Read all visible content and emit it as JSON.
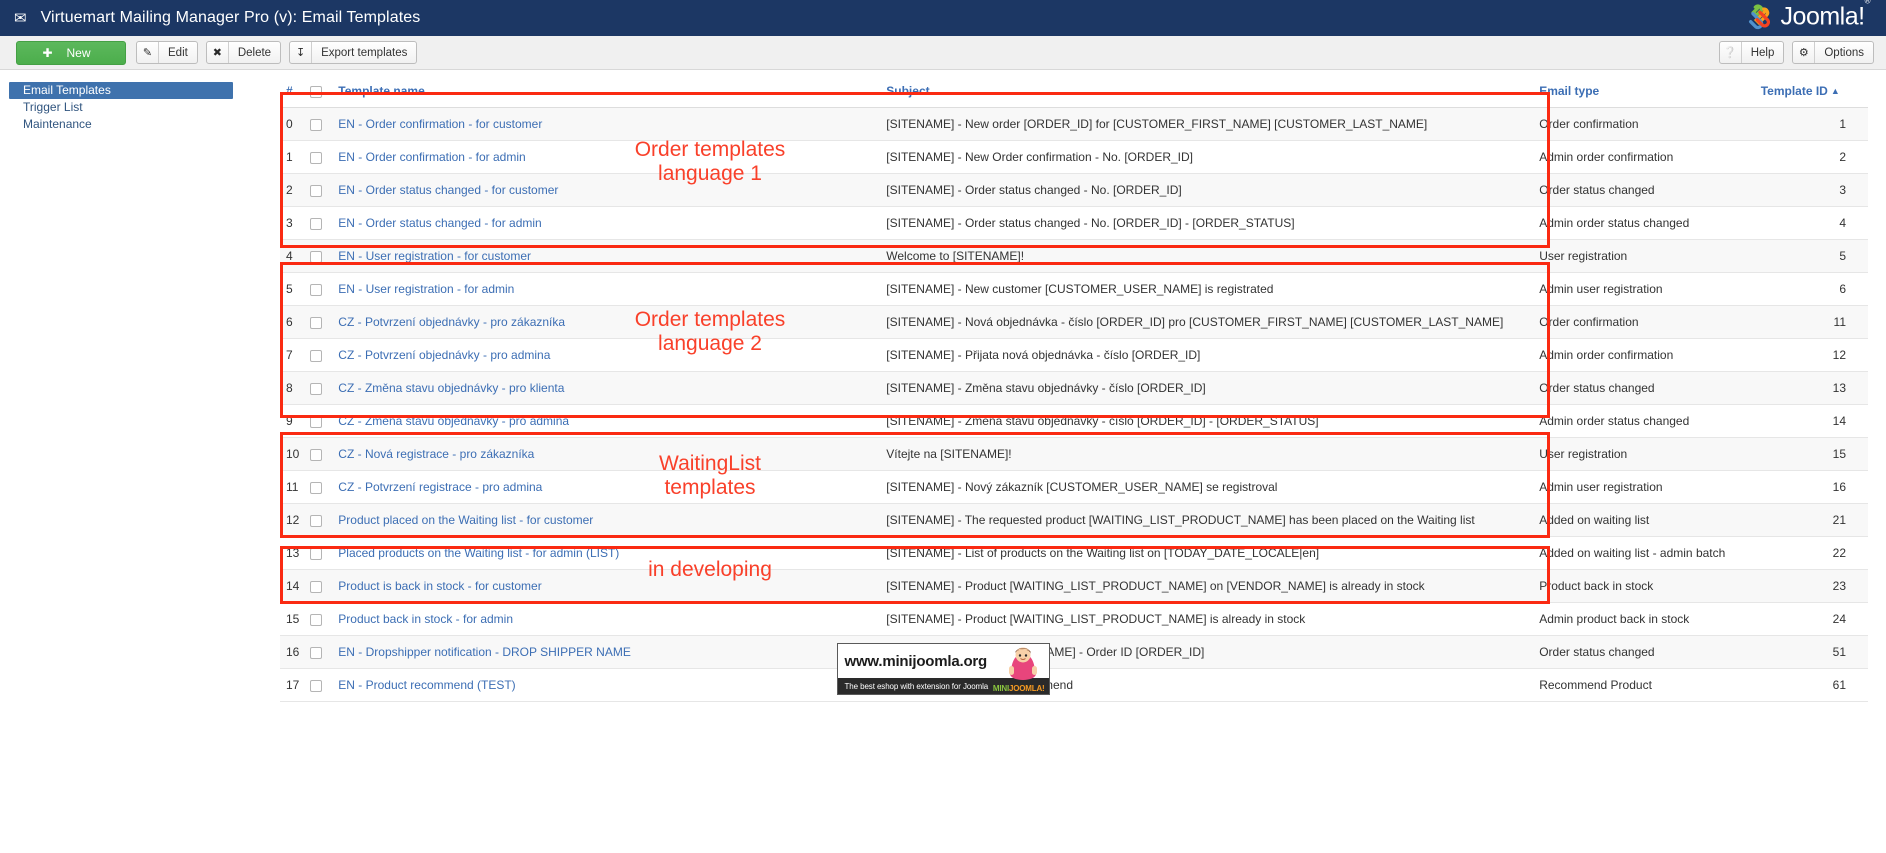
{
  "header": {
    "icon": "envelope-icon",
    "title": "Virtuemart Mailing Manager Pro (v): Email Templates",
    "logo_text": "Joomla!",
    "logo_sup": "®"
  },
  "toolbar": {
    "new_label": "New",
    "new_icon": "plus-circle-icon",
    "edit_label": "Edit",
    "edit_icon": "pencil-square-icon",
    "delete_label": "Delete",
    "delete_icon": "x-mark-icon",
    "export_label": "Export templates",
    "export_icon": "download-icon",
    "help_label": "Help",
    "help_icon": "question-circle-icon",
    "options_label": "Options",
    "options_icon": "gear-icon"
  },
  "sidebar": {
    "items": [
      {
        "label": "Email Templates",
        "active": true
      },
      {
        "label": "Trigger List",
        "active": false
      },
      {
        "label": "Maintenance",
        "active": false
      }
    ]
  },
  "table": {
    "columns": {
      "num": "#",
      "checkbox": "",
      "name": "Template name",
      "subject": "Subject",
      "type": "Email type",
      "id": "Template ID",
      "sort_caret": "▲"
    },
    "rows": [
      {
        "num": "0",
        "name": "EN - Order confirmation - for customer",
        "subject": "[SITENAME] - New order [ORDER_ID] for [CUSTOMER_FIRST_NAME] [CUSTOMER_LAST_NAME]",
        "type": "Order confirmation",
        "id": "1"
      },
      {
        "num": "1",
        "name": "EN - Order confirmation - for admin",
        "subject": "[SITENAME] - New Order confirmation - No. [ORDER_ID]",
        "type": "Admin order confirmation",
        "id": "2"
      },
      {
        "num": "2",
        "name": "EN - Order status changed - for customer",
        "subject": "[SITENAME] - Order status changed - No. [ORDER_ID]",
        "type": "Order status changed",
        "id": "3"
      },
      {
        "num": "3",
        "name": "EN - Order status changed - for admin",
        "subject": "[SITENAME] - Order status changed - No. [ORDER_ID] - [ORDER_STATUS]",
        "type": "Admin order status changed",
        "id": "4"
      },
      {
        "num": "4",
        "name": "EN - User registration - for customer",
        "subject": "Welcome to [SITENAME]!",
        "type": "User registration",
        "id": "5"
      },
      {
        "num": "5",
        "name": "EN - User registration - for admin",
        "subject": "[SITENAME] - New customer [CUSTOMER_USER_NAME] is registrated",
        "type": "Admin user registration",
        "id": "6"
      },
      {
        "num": "6",
        "name": "CZ - Potvrzení objednávky - pro zákazníka",
        "subject": "[SITENAME] - Nová objednávka - číslo [ORDER_ID] pro [CUSTOMER_FIRST_NAME] [CUSTOMER_LAST_NAME]",
        "type": "Order confirmation",
        "id": "11"
      },
      {
        "num": "7",
        "name": "CZ - Potvrzení objednávky - pro admina",
        "subject": "[SITENAME] - Přijata nová objednávka - číslo [ORDER_ID]",
        "type": "Admin order confirmation",
        "id": "12"
      },
      {
        "num": "8",
        "name": "CZ - Změna stavu objednávky - pro klienta",
        "subject": "[SITENAME] - Změna stavu objednávky - číslo [ORDER_ID]",
        "type": "Order status changed",
        "id": "13"
      },
      {
        "num": "9",
        "name": "CZ - Změna stavu objednávky - pro admina",
        "subject": "[SITENAME] - Změna stavu objednávky - číslo [ORDER_ID] - [ORDER_STATUS]",
        "type": "Admin order status changed",
        "id": "14"
      },
      {
        "num": "10",
        "name": "CZ - Nová registrace - pro zákazníka",
        "subject": "Vítejte na [SITENAME]!",
        "type": "User registration",
        "id": "15"
      },
      {
        "num": "11",
        "name": "CZ - Potvrzení registrace - pro admina",
        "subject": "[SITENAME] - Nový zákazník [CUSTOMER_USER_NAME] se registroval",
        "type": "Admin user registration",
        "id": "16"
      },
      {
        "num": "12",
        "name": "Product placed on the Waiting list - for customer",
        "subject": "[SITENAME] - The requested product [WAITING_LIST_PRODUCT_NAME] has been placed on the Waiting list",
        "type": "Added on waiting list",
        "id": "21"
      },
      {
        "num": "13",
        "name": "Placed products on the Waiting list - for admin (LIST)",
        "subject": "[SITENAME] - List of products on the Waiting list on [TODAY_DATE_LOCALE|en]",
        "type": "Added on waiting list - admin batch",
        "id": "22"
      },
      {
        "num": "14",
        "name": "Product is back in stock - for customer",
        "subject": "[SITENAME] - Product [WAITING_LIST_PRODUCT_NAME] on [VENDOR_NAME] is already in stock",
        "type": "Product back in stock",
        "id": "23"
      },
      {
        "num": "15",
        "name": "Product back in stock - for admin",
        "subject": "[SITENAME] - Product [WAITING_LIST_PRODUCT_NAME] is already in stock",
        "type": "Admin product back in stock",
        "id": "24"
      },
      {
        "num": "16",
        "name": "EN - Dropshipper notification - DROP SHIPPER NAME",
        "subject": "Order to ship for [VENDOR_NAME] - Order ID [ORDER_ID]",
        "type": "Order status changed",
        "id": "51"
      },
      {
        "num": "17",
        "name": "EN - Product recommend (TEST)",
        "subject": "[SITENAME] - Product recommend",
        "type": "Recommend Product",
        "id": "61"
      }
    ]
  },
  "annotations": {
    "color": "#fa2a12",
    "groups": [
      {
        "label": "Order templates\nlanguage 1"
      },
      {
        "label": "Order templates\nlanguage 2"
      },
      {
        "label": "WaitingList\ntemplates"
      },
      {
        "label": "in developing"
      }
    ]
  },
  "footer": {
    "banner_title": "www.minijoomla.org",
    "banner_tagline": "The best eshop with extension for Joomla",
    "banner_brand_mini": "MINI",
    "banner_brand_joomla": "JOOMLA!"
  }
}
